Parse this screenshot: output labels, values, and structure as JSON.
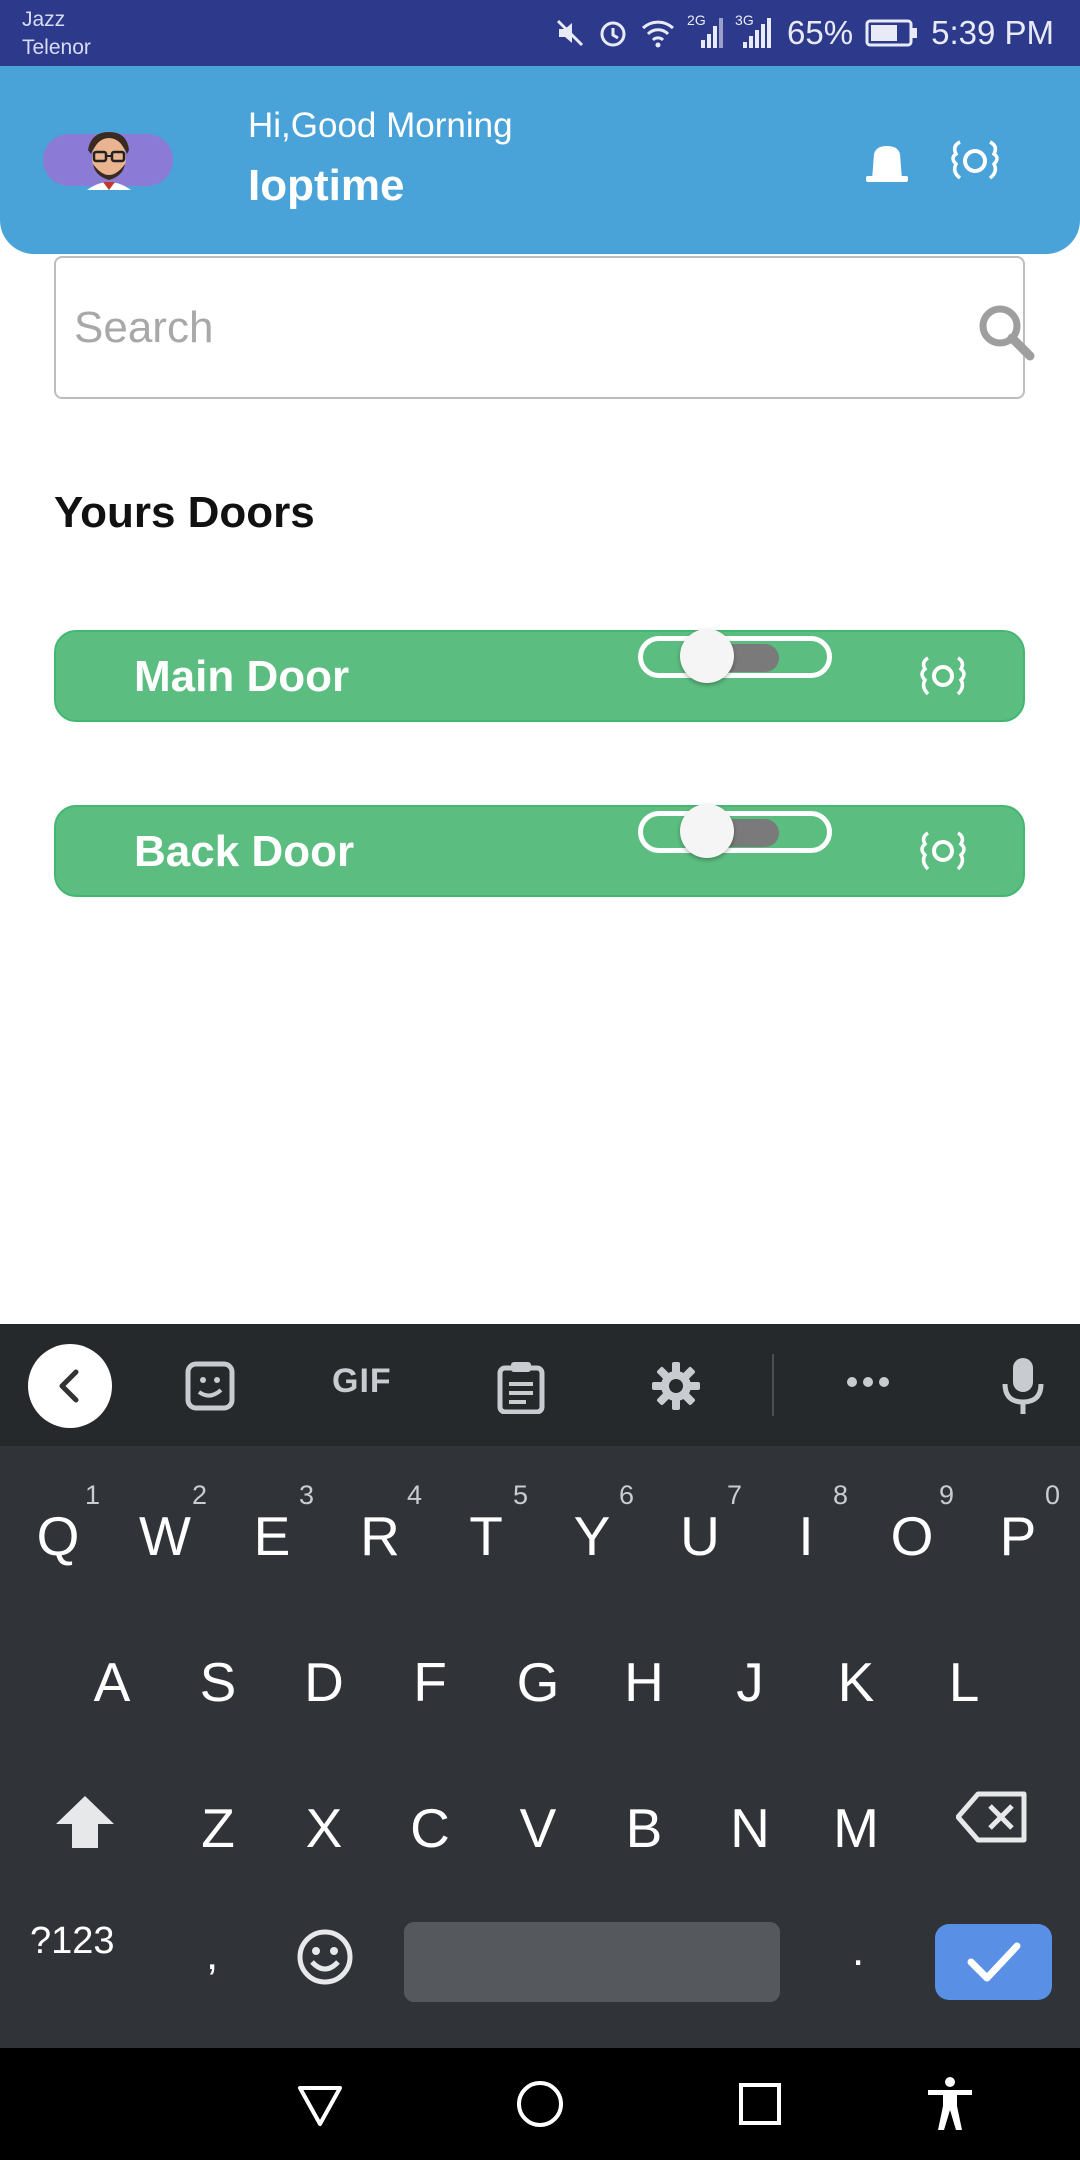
{
  "status_bar": {
    "carrier_1": "Jazz",
    "carrier_2": "Telenor",
    "net_1": "2G",
    "net_2": "3G",
    "battery": "65%",
    "time": "5:39 PM",
    "icons": [
      "mute-icon",
      "alarm-icon",
      "wifi-icon",
      "signal-icon",
      "battery-icon"
    ]
  },
  "header": {
    "greeting": "Hi,Good Morning",
    "username": "Ioptime",
    "color": "#4aa3d8",
    "icons": [
      "avatar",
      "bell-icon",
      "settings-icon"
    ]
  },
  "search": {
    "placeholder": "Search",
    "value": ""
  },
  "section_title": "Yours Doors",
  "doors": [
    {
      "label": "Main Door",
      "toggle_on": false
    },
    {
      "label": "Back Door",
      "toggle_on": false
    }
  ],
  "door_card_color": "#5cbd80",
  "keyboard": {
    "toolbar": {
      "gif": "GIF",
      "icons": [
        "back-chevron-icon",
        "sticker-icon",
        "clipboard-icon",
        "gear-icon",
        "more-icon",
        "mic-icon"
      ]
    },
    "row1": [
      {
        "ch": "Q",
        "num": "1"
      },
      {
        "ch": "W",
        "num": "2"
      },
      {
        "ch": "E",
        "num": "3"
      },
      {
        "ch": "R",
        "num": "4"
      },
      {
        "ch": "T",
        "num": "5"
      },
      {
        "ch": "Y",
        "num": "6"
      },
      {
        "ch": "U",
        "num": "7"
      },
      {
        "ch": "I",
        "num": "8"
      },
      {
        "ch": "O",
        "num": "9"
      },
      {
        "ch": "P",
        "num": "0"
      }
    ],
    "row2": [
      "A",
      "S",
      "D",
      "F",
      "G",
      "H",
      "J",
      "K",
      "L"
    ],
    "row3": [
      "Z",
      "X",
      "C",
      "V",
      "B",
      "N",
      "M"
    ],
    "symbols": "?123",
    "comma": ",",
    "period": "."
  }
}
